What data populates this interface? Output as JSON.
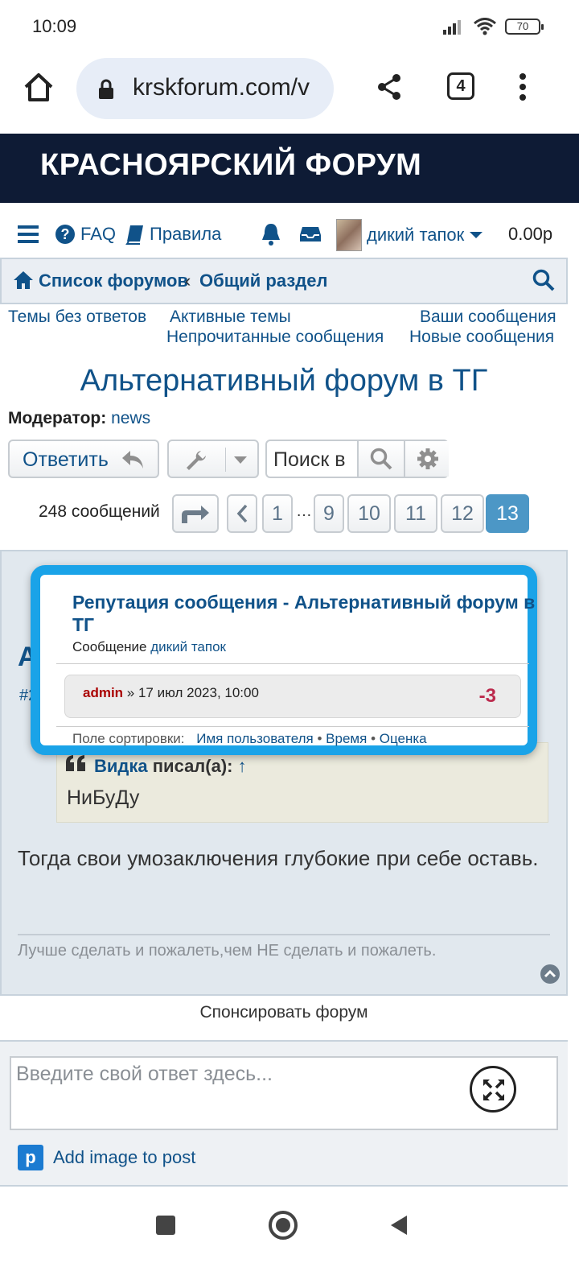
{
  "status_bar": {
    "time": "10:09",
    "battery": "70"
  },
  "browser": {
    "url": "krskforum.com/v",
    "tab_count": "4"
  },
  "site": {
    "title": "КРАСНОЯРСКИЙ ФОРУМ"
  },
  "nav": {
    "faq": "FAQ",
    "rules": "Правила",
    "username": "дикий тапок",
    "balance": "0.00р"
  },
  "breadcrumb": {
    "home": "Список форумов",
    "separator": "‹",
    "section": "Общий раздел"
  },
  "quick_links": {
    "unanswered": "Темы без ответов",
    "active": "Активные темы",
    "your_posts": "Ваши сообщения",
    "unread": "Непрочитанные сообщения",
    "new_posts": "Новые сообщения"
  },
  "topic": {
    "title": "Альтернативный форум в ТГ",
    "moderator_label": "Модератор:",
    "moderator_name": "news"
  },
  "actions": {
    "reply": "Ответить",
    "search_placeholder": "Поиск в"
  },
  "pagination": {
    "count": "248 сообщений",
    "pages": [
      "1",
      "…",
      "9",
      "10",
      "11",
      "12",
      "13"
    ],
    "current": "13"
  },
  "post": {
    "quote_author": "Видка",
    "quote_suffix": "писал(а):",
    "quote_arrow": "↑",
    "quote_text": "НиБуДу",
    "body": "Тогда свои умозаключения глубокие при себе оставь.",
    "signature": "Лучше сделать и пожалеть,чем НЕ сделать и пожалеть.",
    "partial_title": "А",
    "partial_num": "#2"
  },
  "reputation_popup": {
    "title": "Репутация сообщения - Альтернативный форум в ТГ",
    "subtitle_prefix": "Сообщение",
    "subtitle_user": "дикий тапок",
    "entry_user": "admin",
    "entry_date": "» 17 июл 2023, 10:00",
    "entry_score": "-3",
    "sort_label": "Поле сортировки:",
    "sort_username": "Имя пользователя",
    "sort_time": "Время",
    "sort_rating": "Оценка",
    "sort_sep": "•"
  },
  "sponsor": {
    "label": "Спонсировать форум"
  },
  "reply_box": {
    "placeholder": "Введите свой ответ здесь...",
    "add_image": "Add image to post"
  },
  "colors": {
    "header_bg": "#0e1b35",
    "link": "#105289",
    "popup_border": "#1aa3e8",
    "active_page": "#4c97c6"
  }
}
